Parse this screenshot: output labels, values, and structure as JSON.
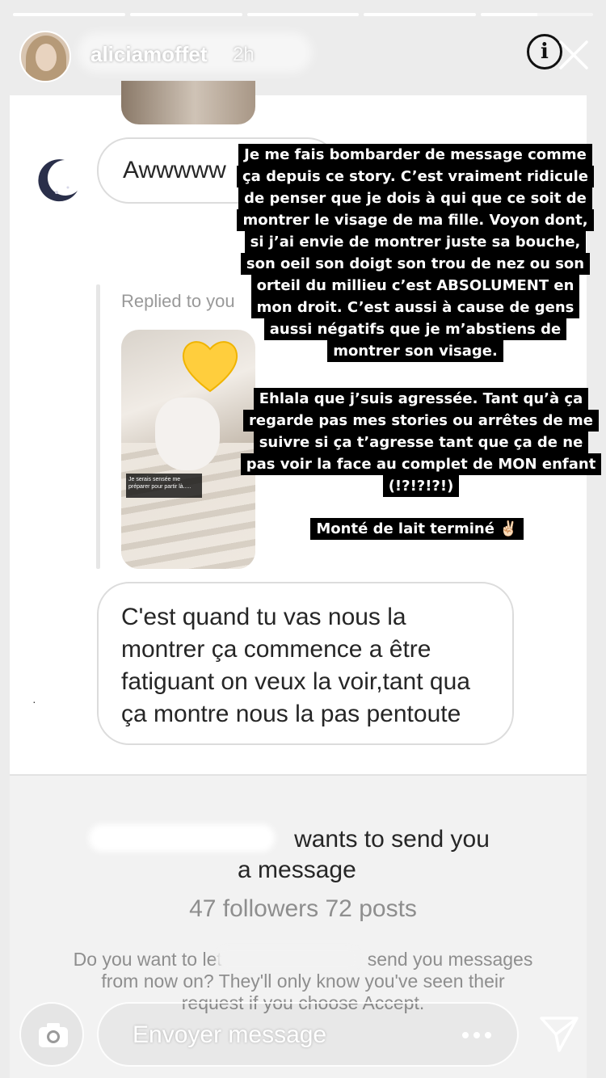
{
  "progress": [
    1,
    1,
    1,
    1,
    0.5
  ],
  "header": {
    "username": "aliciamoffet",
    "time": "2h"
  },
  "chat": {
    "bubble_aw": "Awwwww",
    "replied_label": "Replied to you",
    "photo_caption": "Je serais sensée me préparer pour partir là.....",
    "main_message": "C'est quand tu vas nous la\nmontrer ça commence a être\nfatiguant on veux la voir,tant qua\nça montre nous la pas pentoute"
  },
  "request": {
    "line1": "wants to send you",
    "line2": "a message",
    "stats": "47 followers 72 posts",
    "question_part1": "Do you want to let",
    "question_part2": "send you messages",
    "question_line2": "from now on? They'll only know you've seen their",
    "question_line3": "request if you choose Accept."
  },
  "overlays": {
    "block1": [
      "Je me fais bombarder de message comme",
      "ça depuis ce story. C’est vraiment ridicule",
      "de penser que je dois à qui que ce soit de",
      "montrer le visage de ma fille. Voyon dont,",
      "si j’ai envie de montrer juste sa bouche,",
      "son oeil son doigt son trou de nez ou son",
      "orteil du millieu c’est ABSOLUMENT en",
      "mon droit. C’est aussi à cause de gens",
      "aussi négatifs que je m’abstiens de",
      "montrer son visage."
    ],
    "block2": [
      "Ehlala que j’suis agressée. Tant qu’à ça",
      "regarde pas mes stories ou arrêtes de me",
      "suivre si ça t’agresse tant que ça de ne",
      "pas voir la face au complet de MON enfant",
      "(!?!?!?!)"
    ],
    "block3": "Monté de lait terminé ✌🏻"
  },
  "bottom": {
    "message_placeholder": "Envoyer message"
  },
  "icons": {
    "info": "info-icon",
    "close": "close-icon",
    "camera": "camera-icon",
    "more": "more-icon",
    "send": "send-icon"
  }
}
